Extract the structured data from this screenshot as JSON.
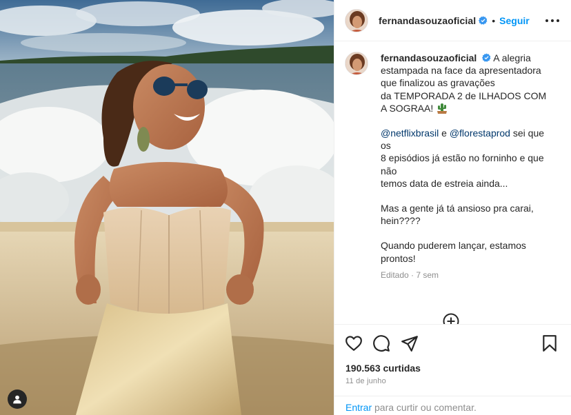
{
  "post": {
    "username": "fernandasouzaoficial",
    "follow_label": "Seguir",
    "dot": "•",
    "verified": true
  },
  "caption": {
    "username": "fernandasouzaoficial",
    "lines_1": [
      "A alegria estampada na face da apresentadora que finalizou as gravações",
      "da TEMPORADA 2 de ILHADOS COM A SOGRAA!"
    ],
    "emoji_icon": "cactus-icon",
    "mention_1": "@netflixbrasil",
    "connector": "e",
    "mention_2": "@florestaprod",
    "line_2a_tail": "sei que os",
    "line_2b": "8 episódios já estão no forninho e que não",
    "line_2c": "temos data de estreia ainda...",
    "line_3": "Mas a gente já tá ansioso pra carai, hein????",
    "line_4": "Quando puderem lançar, estamos prontos!",
    "meta": "Editado · 7 sem"
  },
  "engagement": {
    "likes": "190.563 curtidas",
    "date": "11 de junho"
  },
  "comment_box": {
    "enter_label": "Entrar",
    "rest": "para curtir ou comentar."
  },
  "icons": {
    "like": "heart-icon",
    "comment": "comment-icon",
    "share": "share-icon",
    "save": "bookmark-icon",
    "more": "more-options-icon",
    "load_more": "plus-circle-icon",
    "tags": "user-tag-icon"
  },
  "colors": {
    "link_blue": "#0095f6",
    "mention_blue": "#00376b",
    "muted": "#8e8e8e",
    "text": "#262626"
  }
}
